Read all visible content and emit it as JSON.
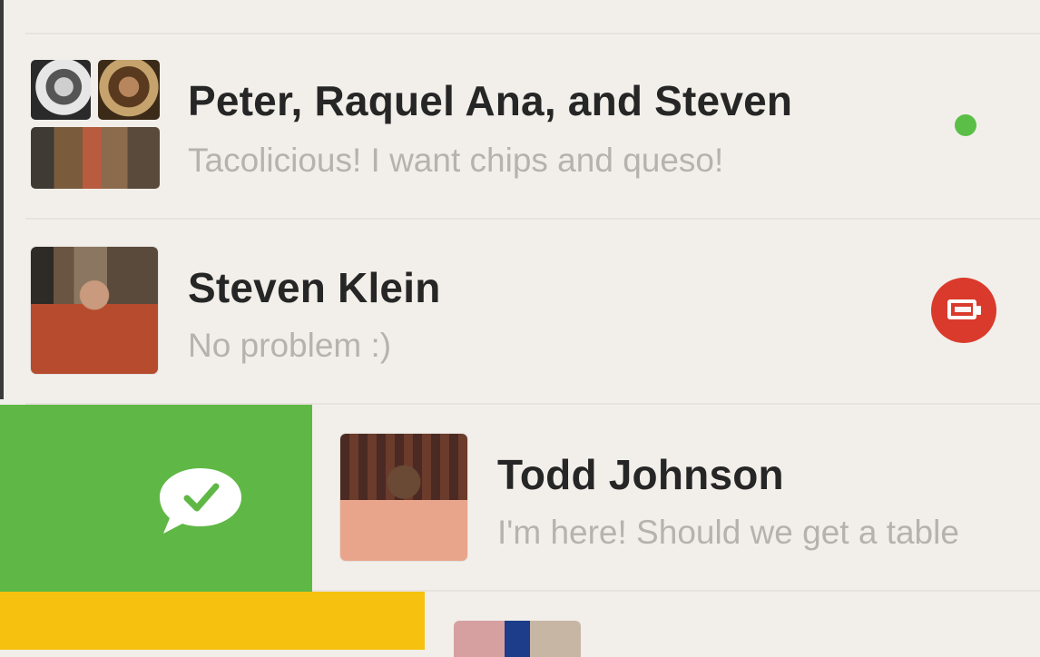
{
  "conversations": [
    {
      "title": "Peter, Raquel Ana, and Steven",
      "preview": "Tacolicious! I want chips and queso!",
      "status": "online",
      "status_color": "#5bbf47"
    },
    {
      "title": "Steven Klein",
      "preview": "No problem :)",
      "badge": "battery-low",
      "badge_color": "#da3a2b"
    },
    {
      "title": "Todd Johnson",
      "preview": "I'm here! Should we get a table",
      "swipe_action": "mark-read",
      "swipe_color": "#5fb845"
    }
  ],
  "swipe_colors": {
    "green": "#5fb845",
    "yellow": "#f6c20f"
  },
  "icons": [
    "chat-check-icon",
    "battery-icon",
    "online-status-icon",
    "group-avatar",
    "avatar"
  ]
}
